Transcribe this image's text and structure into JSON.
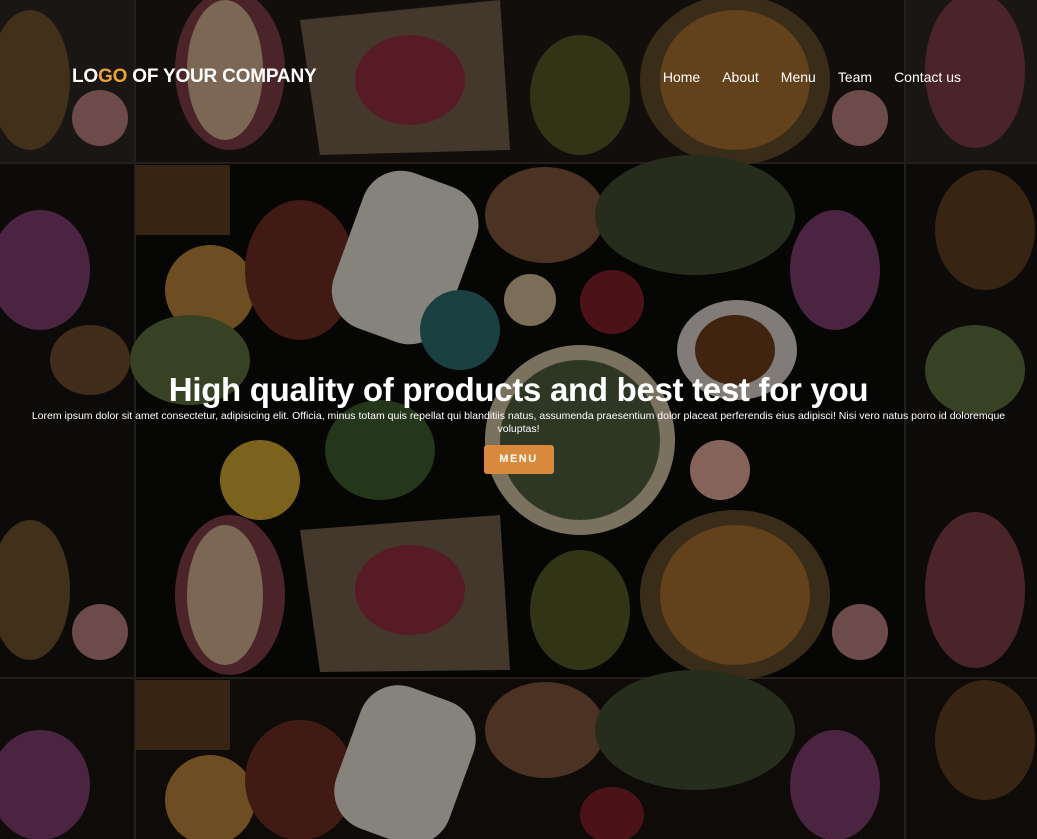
{
  "header": {
    "logo_part1": "LO",
    "logo_accent": "GO",
    "logo_part2": " OF YOUR COMPANY",
    "nav": [
      {
        "label": "Home"
      },
      {
        "label": "About"
      },
      {
        "label": "Menu"
      },
      {
        "label": "Team"
      },
      {
        "label": "Contact us"
      }
    ]
  },
  "hero": {
    "title": "High quality of products and best test for you",
    "description": "Lorem ipsum dolor sit amet consectetur, adipisicing elit. Officia, minus totam quis repellat qui blanditiis natus, assumenda praesentium dolor placeat perferendis eius adipisci! Nisi vero natus porro id doloremque voluptas!",
    "button_label": "MENU"
  },
  "colors": {
    "accent": "#e8a13b",
    "button": "#d9893b",
    "text": "#ffffff",
    "background": "#0a0908"
  },
  "background": {
    "type": "tiled food photography"
  }
}
